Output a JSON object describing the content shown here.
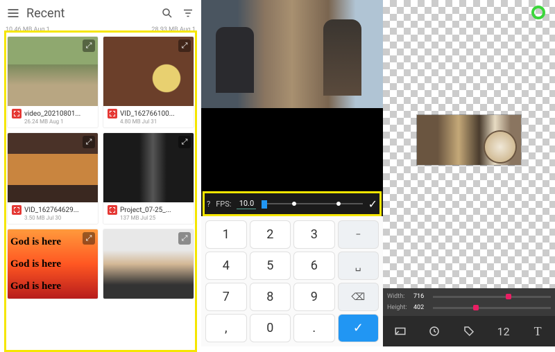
{
  "panel1": {
    "title": "Recent",
    "top_sub_left": "10.46 MB  Aug 1",
    "top_sub_right": "28.93 MB  Aug 1",
    "items": [
      {
        "name": "video_20210801...",
        "meta": "26.24 MB  Aug 1"
      },
      {
        "name": "VID_162766100...",
        "meta": "4.80 MB  Jul 31"
      },
      {
        "name": "VID_162764629...",
        "meta": "3.50 MB  Jul 30"
      },
      {
        "name": "Project_07-25_...",
        "meta": "137 MB  Jul 25"
      }
    ],
    "bottom_text": "God is here"
  },
  "panel2": {
    "help": "?",
    "fps_label": "FPS:",
    "fps_value": "10.0",
    "keys": {
      "r0": [
        "1",
        "2",
        "3",
        "−"
      ],
      "r1": [
        "4",
        "5",
        "6",
        "␣"
      ],
      "r2": [
        "7",
        "8",
        "9",
        "⌫"
      ],
      "r3": [
        ",",
        "0",
        ".",
        "✓"
      ]
    }
  },
  "panel3": {
    "width_label": "Width:",
    "width_value": "716",
    "height_label": "Height:",
    "height_value": "402",
    "tool_number": "12"
  }
}
